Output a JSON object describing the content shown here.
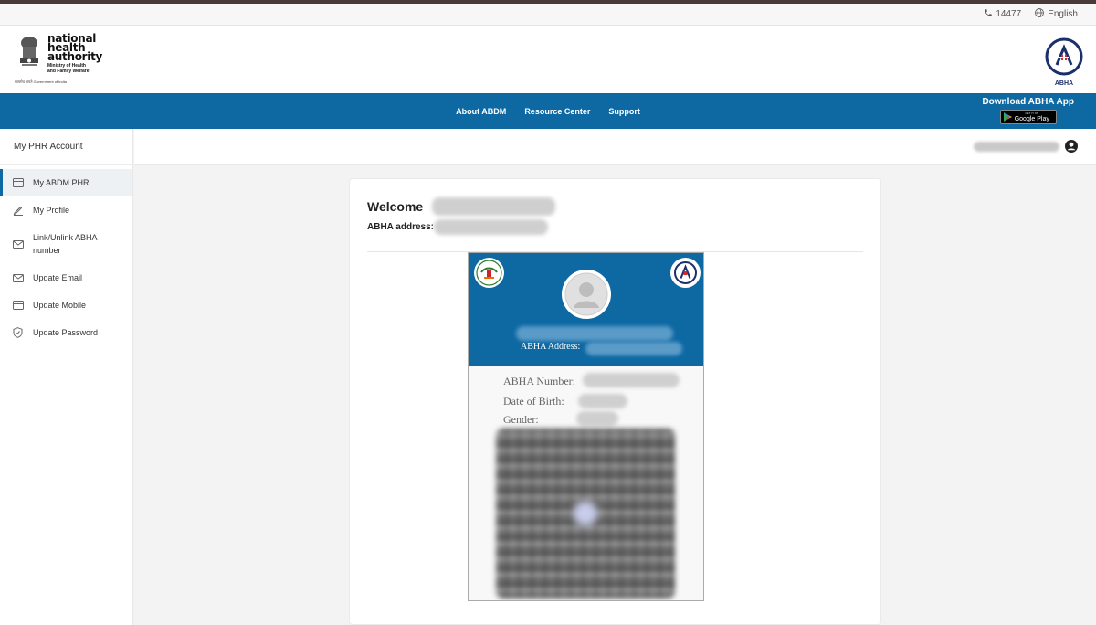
{
  "utility": {
    "phone": "14477",
    "language": "English"
  },
  "header": {
    "org_line1": "national",
    "org_line2": "health",
    "org_line3": "authority",
    "ministry_line1": "Ministry of Health",
    "ministry_line2": "and Family Welfare",
    "gov_line": "सत्यमेव जयते    Government of India",
    "abha_logo_label": "ABHA"
  },
  "nav": {
    "links": [
      "About ABDM",
      "Resource Center",
      "Support"
    ],
    "download_title": "Download ABHA App",
    "gplay_small": "GET IT ON",
    "gplay_big": "Google Play"
  },
  "sidebar": {
    "title": "My PHR Account",
    "items": [
      {
        "label": "My ABDM PHR",
        "icon": "card-icon",
        "active": true
      },
      {
        "label": "My Profile",
        "icon": "pencil-icon",
        "active": false
      },
      {
        "label": "Link/Unlink ABHA number",
        "icon": "mail-icon",
        "active": false
      },
      {
        "label": "Update Email",
        "icon": "mail-icon",
        "active": false
      },
      {
        "label": "Update Mobile",
        "icon": "card-icon",
        "active": false
      },
      {
        "label": "Update Password",
        "icon": "shield-icon",
        "active": false
      }
    ]
  },
  "main": {
    "welcome_label": "Welcome",
    "abha_address_label": "ABHA address:",
    "card": {
      "address_label": "ABHA Address:",
      "number_label": "ABHA Number:",
      "dob_label": "Date of Birth:",
      "gender_label": "Gender:"
    }
  },
  "colors": {
    "brand_blue": "#0e69a3",
    "background": "#f3f3f4"
  }
}
